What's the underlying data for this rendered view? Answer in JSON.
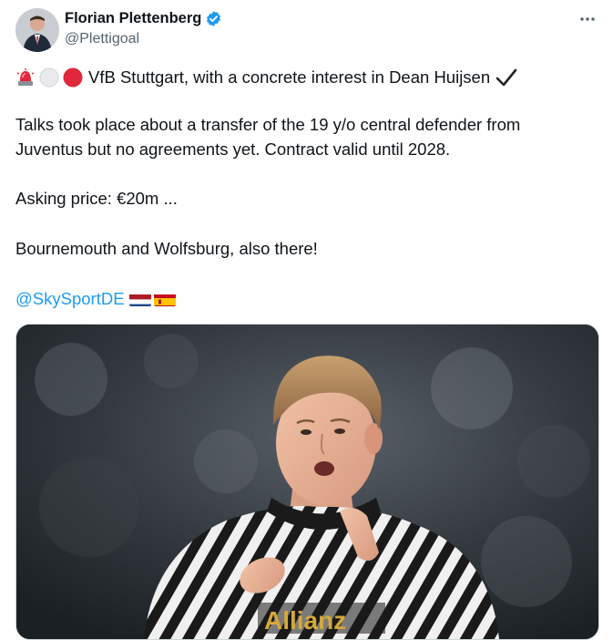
{
  "author": {
    "display_name": "Florian Plettenberg",
    "handle": "@Plettigoal",
    "verified_icon": "verified-badge-icon",
    "avatar_icon": "profile-avatar"
  },
  "menu": {
    "more_icon": "more-options-icon"
  },
  "tweet": {
    "line1_text": "VfB Stuttgart, with a concrete interest in Dean Huijsen",
    "line1_emojis": [
      "police-light-emoji",
      "white-circle-emoji",
      "red-circle-emoji",
      "check-mark-emoji"
    ],
    "line2": "Talks took place about a transfer of the 19 y/o central defender from",
    "line3": "Juventus but no agreements yet. Contract valid until 2028.",
    "line4": "Asking price: €20m ...",
    "line5": "Bournemouth and Wolfsburg, also there!",
    "mention": "@SkySportDE",
    "flags": [
      "netherlands-flag",
      "spain-flag"
    ]
  },
  "media": {
    "kind": "photo",
    "jersey_text": "Allianz"
  },
  "colors": {
    "accent": "#1d9bf0",
    "text": "#0f1419",
    "secondary": "#536471"
  }
}
